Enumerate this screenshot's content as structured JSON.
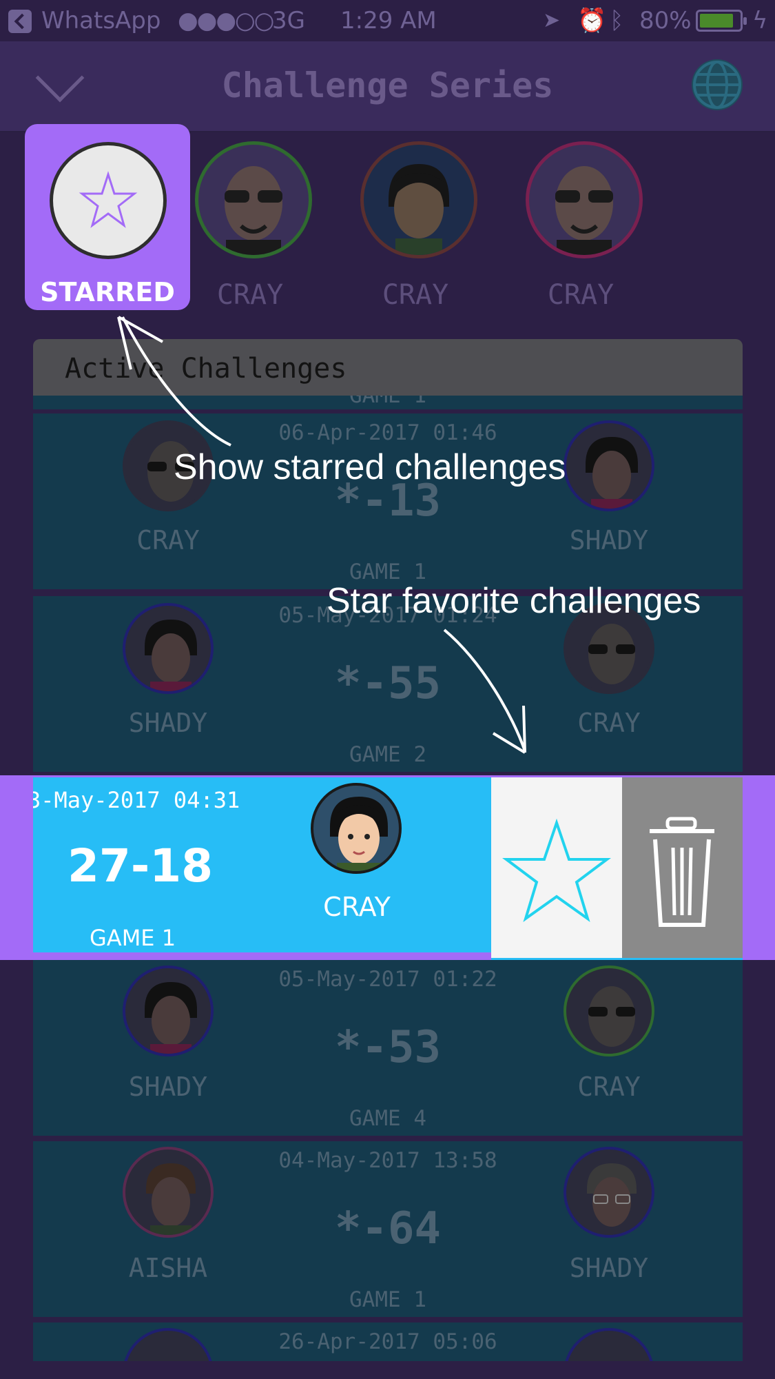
{
  "status_bar": {
    "back_app": "WhatsApp",
    "signal": "●●●○○",
    "network": "3G",
    "time": "1:29 AM",
    "battery_pct": "80%"
  },
  "header": {
    "title": "Challenge Series"
  },
  "player_filter": [
    {
      "label": "STARRED",
      "selected": true
    },
    {
      "label": "CRAY"
    },
    {
      "label": "CRAY"
    },
    {
      "label": "CRAY"
    }
  ],
  "section": {
    "title": "Active Challenges",
    "partial_top_game": "GAME 1"
  },
  "cards": [
    {
      "date": "06-Apr-2017 01:46",
      "score": "*-13",
      "game": "GAME 1",
      "left_player": "CRAY",
      "right_player": "SHADY"
    },
    {
      "date": "05-May-2017 01:24",
      "score": "*-55",
      "game": "GAME 2",
      "left_player": "SHADY",
      "right_player": "CRAY"
    },
    {
      "date": "05-May-2017 01:22",
      "score": "*-53",
      "game": "GAME 4",
      "left_player": "SHADY",
      "right_player": "CRAY"
    },
    {
      "date": "04-May-2017 13:58",
      "score": "*-64",
      "game": "GAME 1",
      "left_player": "AISHA",
      "right_player": "SHADY"
    },
    {
      "date": "26-Apr-2017 05:06",
      "score": "",
      "game": "",
      "left_player": "",
      "right_player": ""
    }
  ],
  "swiped_card": {
    "date": "3-May-2017 04:31",
    "score": "27-18",
    "game": "GAME 1",
    "player": "CRAY"
  },
  "annotations": {
    "show_starred": "Show  starred challenges",
    "star_favorite": "Star favorite challenges"
  },
  "colors": {
    "accent": "#a36bf7",
    "card_bg": "#143a4d",
    "swipe_bg": "#27bdf6",
    "star_stroke": "#22d3ee",
    "delete_bg": "#8a8a8a"
  }
}
